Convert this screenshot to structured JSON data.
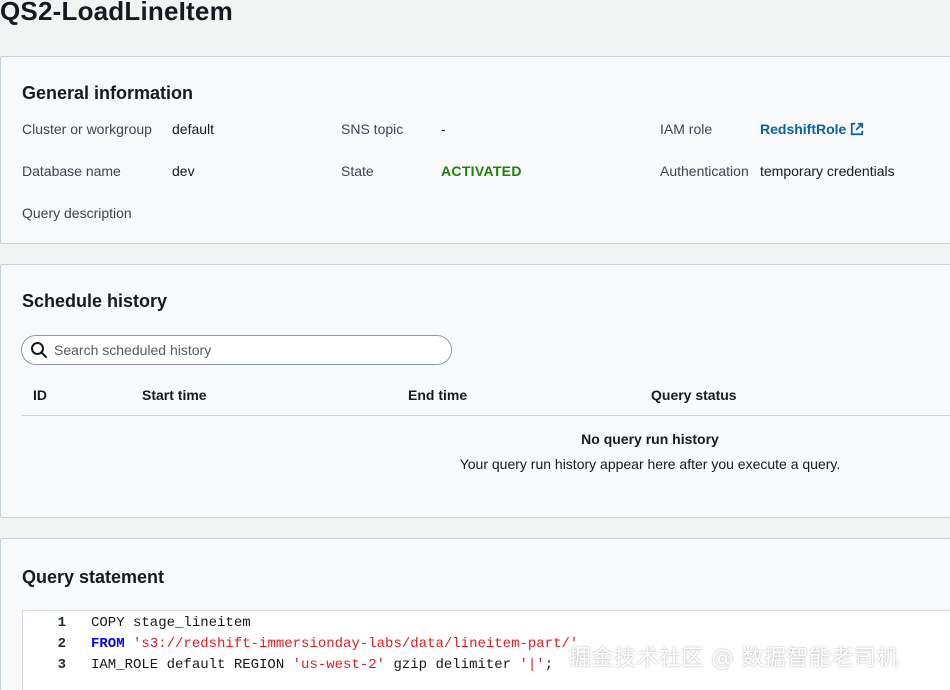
{
  "page": {
    "title": "QS2-LoadLineItem"
  },
  "general": {
    "heading": "General information",
    "fields": {
      "cluster_label": "Cluster or workgroup",
      "cluster_value": "default",
      "database_label": "Database name",
      "database_value": "dev",
      "description_label": "Query description",
      "sns_label": "SNS topic",
      "sns_value": "-",
      "state_label": "State",
      "state_value": "ACTIVATED",
      "iam_label": "IAM role",
      "iam_value": "RedshiftRole",
      "auth_label": "Authentication",
      "auth_value": "temporary credentials"
    },
    "state_color": "#1d8102",
    "link_color": "#0a62a5"
  },
  "schedule": {
    "heading": "Schedule history",
    "search_placeholder": "Search scheduled history",
    "search_value": "",
    "columns": [
      "ID",
      "Start time",
      "End time",
      "Query status"
    ],
    "empty_title": "No query run history",
    "empty_message": "Your query run history appear here after you execute a query."
  },
  "query": {
    "heading": "Query statement",
    "lines": [
      {
        "num": "1",
        "tokens": [
          {
            "t": "plain",
            "v": "COPY stage_lineitem"
          }
        ]
      },
      {
        "num": "2",
        "tokens": [
          {
            "t": "kw",
            "v": "FROM"
          },
          {
            "t": "plain",
            "v": " "
          },
          {
            "t": "str",
            "v": "'s3://redshift-immersionday-labs/data/lineitem-part/'"
          }
        ]
      },
      {
        "num": "3",
        "tokens": [
          {
            "t": "plain",
            "v": "IAM_ROLE default REGION "
          },
          {
            "t": "str",
            "v": "'us-west-2'"
          },
          {
            "t": "plain",
            "v": " gzip delimiter "
          },
          {
            "t": "str",
            "v": "'|'"
          },
          {
            "t": "plain",
            "v": ";"
          }
        ]
      }
    ]
  },
  "watermark": {
    "text": "掘金技术社区 @ 数据智能老司机"
  },
  "icons": {
    "search": "search-icon",
    "external": "external-link-icon"
  }
}
